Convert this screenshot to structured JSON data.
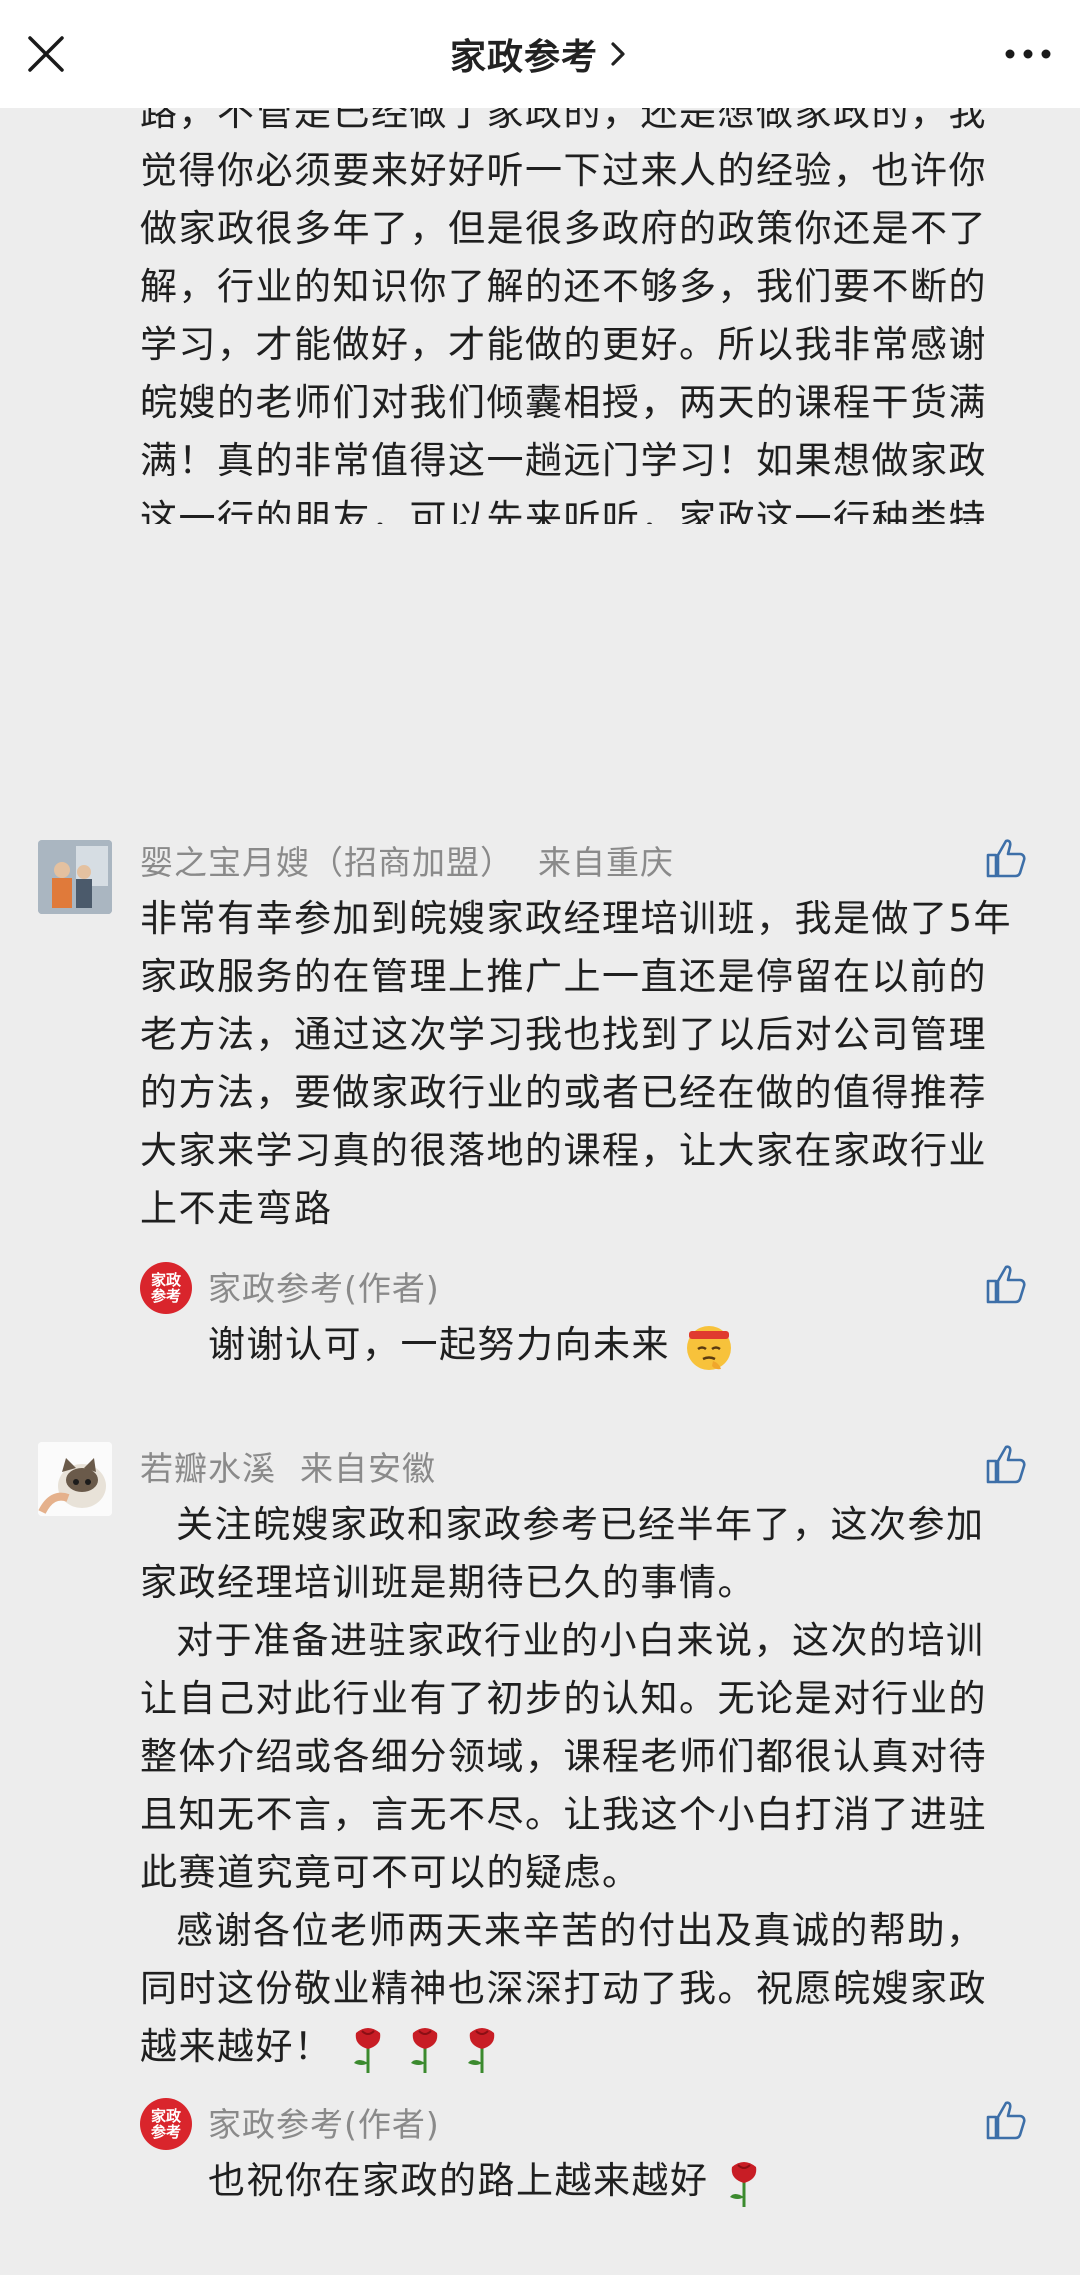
{
  "header": {
    "title": "家政参考",
    "close_icon": "close-icon",
    "more_icon": "more-icon"
  },
  "first_comment_tail": "路，不管是已经做了家政的，还是想做家政的，我觉得你必须要来好好听一下过来人的经验，也许你做家政很多年了，但是很多政府的政策你还是不了解，行业的知识你了解的还不够多，我们要不断的学习，才能做好，才能做的更好。所以我非常感谢皖嫂的老师们对我们倾囊相授，两天的课程干货满满！真的非常值得这一趟远门学习！如果想做家政这一行的朋友，可以先来听听，家政这一行种类特别多，入行之前一定要做好定位，坚定信念，才能越走越远！",
  "comments": [
    {
      "name": "婴之宝月嫂（招商加盟）",
      "location": "来自重庆",
      "text": "非常有幸参加到皖嫂家政经理培训班，我是做了5年家政服务的在管理上推广上一直还是停留在以前的老方法，通过这次学习我也找到了以后对公司管理的方法，要做家政行业的或者已经在做的值得推荐大家来学习真的很落地的课程，让大家在家政行业上不走弯路",
      "reply": {
        "author": "家政参考(作者)",
        "logo_text": "家政参考",
        "text": "谢谢认可，一起努力向未来"
      }
    },
    {
      "name": "若瓣水溪",
      "location": "来自安徽",
      "paragraphs": [
        "关注皖嫂家政和家政参考已经半年了，这次参加家政经理培训班是期待已久的事情。",
        "对于准备进驻家政行业的小白来说，这次的培训让自己对此行业有了初步的认知。无论是对行业的整体介绍或各细分领域，课程老师们都很认真对待且知无不言，言无不尽。让我这个小白打消了进驻此赛道究竟可不可以的疑虑。",
        "感谢各位老师两天来辛苦的付出及真诚的帮助，同时这份敬业精神也深深打动了我。祝愿皖嫂家政越来越好！"
      ],
      "reply": {
        "author": "家政参考(作者)",
        "logo_text": "家政参考",
        "text": "也祝你在家政的路上越来越好"
      }
    }
  ],
  "colors": {
    "background": "#ededed",
    "secondary_text": "#8a8a8a",
    "like_icon": "#3d6fa8",
    "author_logo": "#d9252c",
    "rose": "#c81d25"
  }
}
